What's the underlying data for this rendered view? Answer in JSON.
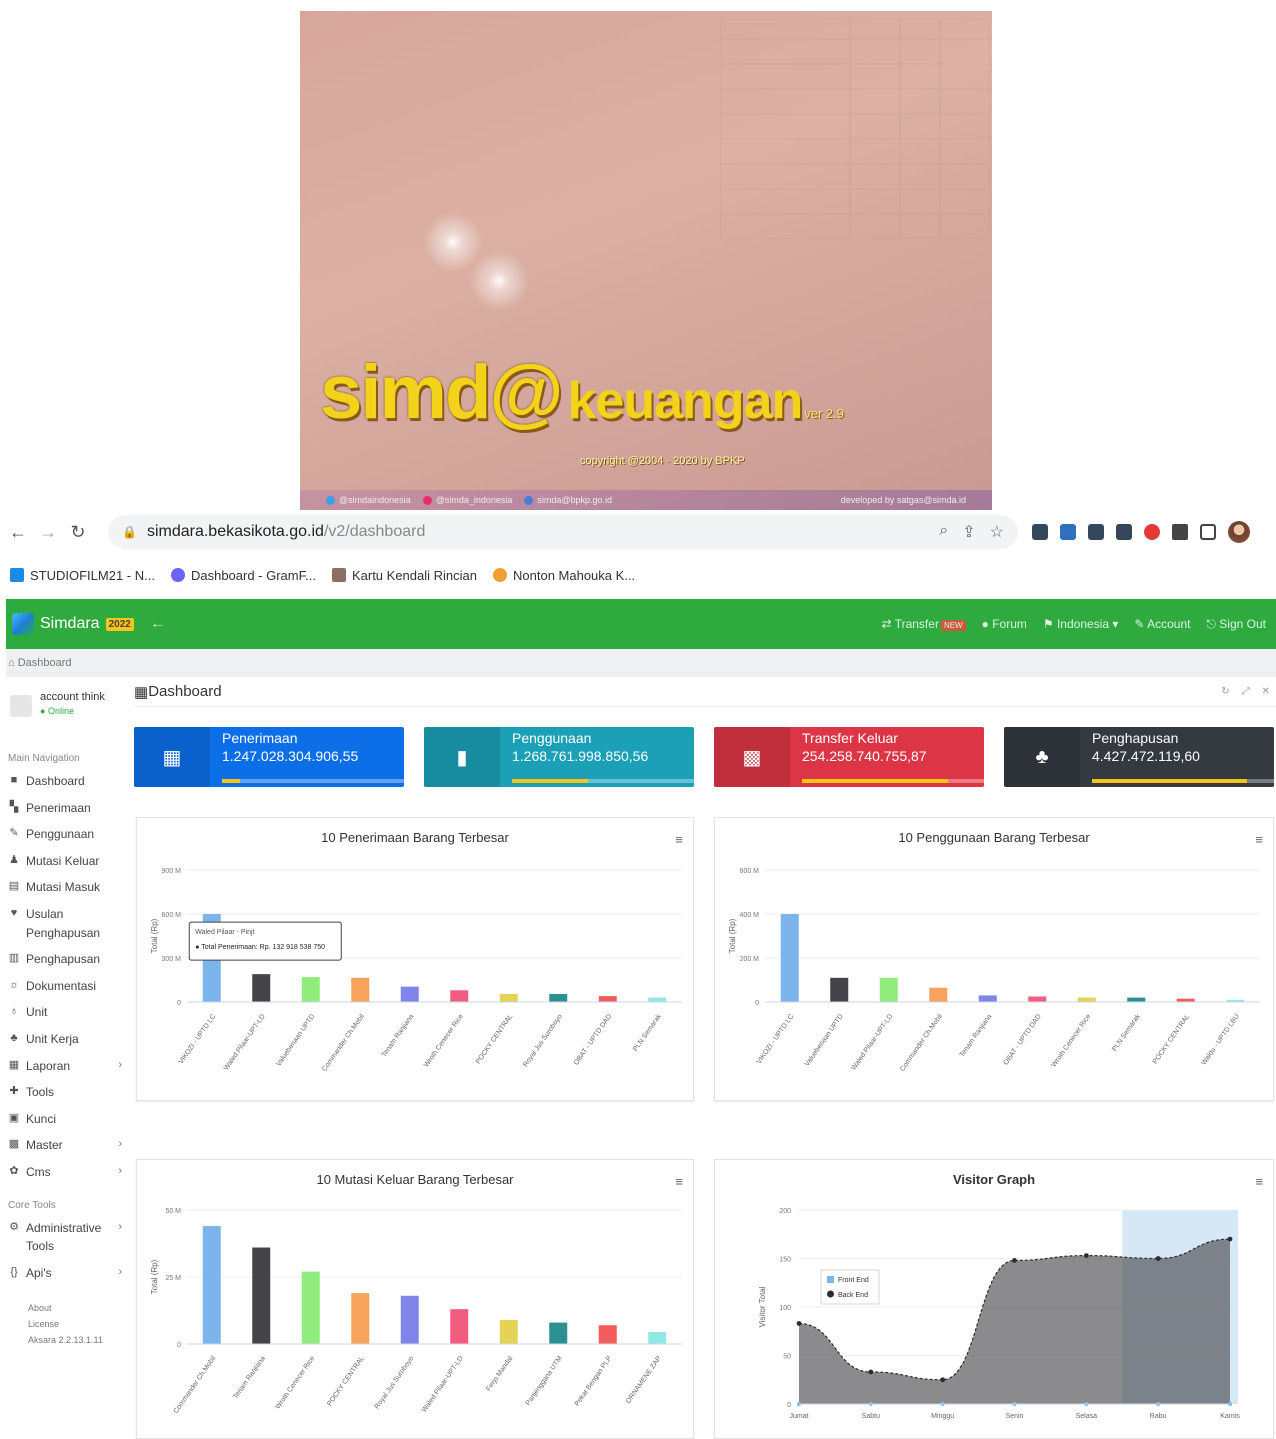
{
  "splash": {
    "brand_big": "simd@",
    "brand_word": "keuangan",
    "version": "ver 2.9",
    "copyright": "copyright @2004 - 2020 by BPKP",
    "social": [
      {
        "icon": "twitter-icon",
        "label": "@simdaindonesia",
        "color": "#3aa0e8"
      },
      {
        "icon": "instagram-icon",
        "label": "@simda_indonesia",
        "color": "#e1306c"
      },
      {
        "icon": "mail-icon",
        "label": "simda@bpkp.go.id",
        "color": "#4a7bd6"
      }
    ],
    "developer": "developed by satgas@simda.id"
  },
  "browser": {
    "url_host": "simdara.bekasikota.go.id",
    "url_path": "/v2/dashboard",
    "bookmarks": [
      {
        "label": "STUDIOFILM21 - N...",
        "color": "#1e88e5"
      },
      {
        "label": "Dashboard - GramF...",
        "color": "#6c63ff"
      },
      {
        "label": "Kartu Kendali Rincian",
        "color": "#8d6e63"
      },
      {
        "label": "Nonton Mahouka K...",
        "color": "#f0a030"
      }
    ]
  },
  "app": {
    "name": "Simdara",
    "year": "2022",
    "menu": {
      "transfer": "Transfer",
      "transfer_badge": "NEW",
      "forum": "Forum",
      "language": "Indonesia",
      "account": "Account",
      "signout": "Sign Out"
    },
    "breadcrumb": "Dashboard",
    "page_title": "Dashboard"
  },
  "user": {
    "name": "account think",
    "status": "Online"
  },
  "sidebar": {
    "main_header": "Main Navigation",
    "items": [
      {
        "label": "Dashboard",
        "icon": "■",
        "chev": ""
      },
      {
        "label": "Penerimaan",
        "icon": "▚",
        "chev": ""
      },
      {
        "label": "Penggunaan",
        "icon": "✎",
        "chev": ""
      },
      {
        "label": "Mutasi Keluar",
        "icon": "♟",
        "chev": ""
      },
      {
        "label": "Mutasi Masuk",
        "icon": "▤",
        "chev": ""
      },
      {
        "label": "Usulan Penghapusan",
        "icon": "♥",
        "chev": ""
      },
      {
        "label": "Penghapusan",
        "icon": "▥",
        "chev": ""
      },
      {
        "label": "Dokumentasi",
        "icon": "☼",
        "chev": ""
      },
      {
        "label": "Unit",
        "icon": "♁",
        "chev": ""
      },
      {
        "label": "Unit Kerja",
        "icon": "♣",
        "chev": ""
      },
      {
        "label": "Laporan",
        "icon": "▦",
        "chev": "›"
      },
      {
        "label": "Tools",
        "icon": "✚",
        "chev": ""
      },
      {
        "label": "Kunci",
        "icon": "▣",
        "chev": ""
      },
      {
        "label": "Master",
        "icon": "▩",
        "chev": "›"
      },
      {
        "label": "Cms",
        "icon": "✿",
        "chev": "›"
      }
    ],
    "core_header": "Core Tools",
    "core_items": [
      {
        "label": "Administrative Tools",
        "icon": "⚙",
        "chev": "›"
      },
      {
        "label": "Api's",
        "icon": "{}",
        "chev": "›"
      }
    ],
    "footer": [
      "About",
      "License",
      "Aksara 2.2.13.1.11"
    ]
  },
  "info_boxes": [
    {
      "label": "Penerimaan",
      "value": "1.247.028.304.906,55",
      "color": "#0d6fe8",
      "icon": "▦",
      "progress": 0.1
    },
    {
      "label": "Penggunaan",
      "value": "1.268.761.998.850,56",
      "color": "#1ba0b8",
      "icon": "▮",
      "progress": 0.42
    },
    {
      "label": "Transfer Keluar",
      "value": "254.258.740.755,87",
      "color": "#dc3545",
      "icon": "▩",
      "progress": 0.8
    },
    {
      "label": "Penghapusan",
      "value": "4.427.472.119,60",
      "color": "#343a40",
      "icon": "♣",
      "progress": 0.85
    }
  ],
  "chart_data": [
    {
      "type": "bar",
      "title": "10 Penerimaan Barang Terbesar",
      "ylabel": "Total (Rp)",
      "yticks": [
        "0",
        "300 M",
        "600 M",
        "900 M"
      ],
      "ylim": [
        0,
        900
      ],
      "categories": [
        "VIKOZI - UPTD LC",
        "Waled Pilaar-UPT-LD",
        "Valuebenaan UPTD",
        "Commander Ch.Mobil",
        "Tenam Ranjiana",
        "Wroth Cenecer Rice",
        "POCKY CENTRAL",
        "Royal Jus Suroboyo",
        "OBAT - UPTD DAD",
        "PLN Semarak"
      ],
      "values": [
        600,
        190,
        170,
        165,
        105,
        80,
        55,
        55,
        40,
        30
      ],
      "colors": [
        "#7cb5ec",
        "#434348",
        "#90ed7d",
        "#f7a35c",
        "#8085e9",
        "#f15c80",
        "#e4d354",
        "#2b908f",
        "#f45b5b",
        "#91e8e1"
      ],
      "tooltip": {
        "header": "Waled Pilaar - Pinjt",
        "text": "Total Penerimaan: Rp. 132 918 538 750"
      }
    },
    {
      "type": "bar",
      "title": "10 Penggunaan Barang Terbesar",
      "ylabel": "Total (Rp)",
      "yticks": [
        "0",
        "200 M",
        "400 M",
        "600 M"
      ],
      "ylim": [
        0,
        600
      ],
      "categories": [
        "VIKOZI - UPTD LC",
        "Valuebenaan UPTD",
        "Waled Pilaar-UPT-LD",
        "Commander Ch.Mobil",
        "Tenam Ranjiana",
        "OBAT - UPTD DAD",
        "Wroth Cenecer Rice",
        "PLN Semarak",
        "POCKY CENTRAL",
        "Waldu - UPTD LBU"
      ],
      "values": [
        400,
        110,
        110,
        65,
        30,
        25,
        20,
        20,
        15,
        10
      ],
      "colors": [
        "#7cb5ec",
        "#434348",
        "#90ed7d",
        "#f7a35c",
        "#8085e9",
        "#f15c80",
        "#e4d354",
        "#2b908f",
        "#f45b5b",
        "#91e8e1"
      ]
    },
    {
      "type": "bar",
      "title": "10 Mutasi Keluar Barang Terbesar",
      "ylabel": "Total (Rp)",
      "yticks": [
        "0",
        "25 M",
        "50 M"
      ],
      "ylim": [
        0,
        50
      ],
      "categories": [
        "Commander Ch.Mobil",
        "Tenam Ranjiana",
        "Wroth Cenecer Rice",
        "POCKY CENTRAL",
        "Royal Jus Suroboyo",
        "Waled Pilaar-UPT-LD",
        "Ferjo Mandal",
        "Panjenggana UTM",
        "Pekat Bengan PLP",
        "ORNAMENE ZAP"
      ],
      "values": [
        44,
        36,
        27,
        19,
        18,
        13,
        9,
        8,
        7,
        4.5
      ],
      "colors": [
        "#7cb5ec",
        "#434348",
        "#90ed7d",
        "#f7a35c",
        "#8085e9",
        "#f15c80",
        "#e4d354",
        "#2b908f",
        "#f45b5b",
        "#91e8e1"
      ]
    },
    {
      "type": "area",
      "title": "Visitor Graph",
      "ylabel": "Visitor Total",
      "yticks": [
        "0",
        "50",
        "100",
        "150",
        "200"
      ],
      "ylim": [
        0,
        200
      ],
      "categories": [
        "Jumat",
        "Sabtu",
        "Minggu",
        "Senin",
        "Selasa",
        "Rabu",
        "Kamis"
      ],
      "series": [
        {
          "name": "Front End",
          "values": [
            0,
            0,
            0,
            0,
            0,
            0,
            0
          ],
          "color": "#7cb5ec"
        },
        {
          "name": "Back End",
          "values": [
            83,
            33,
            25,
            148,
            153,
            150,
            170
          ],
          "color": "#434348"
        }
      ],
      "highlight_from_category": "Rabu"
    }
  ]
}
